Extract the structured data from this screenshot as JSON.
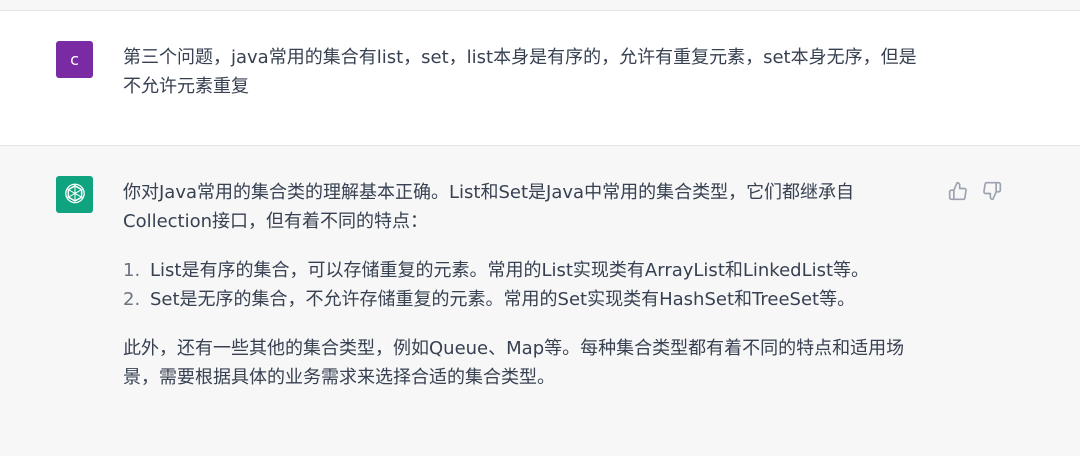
{
  "user_message": {
    "avatar_letter": "c",
    "text": "第三个问题，java常用的集合有list，set，list本身是有序的，允许有重复元素，set本身无序，但是不允许元素重复"
  },
  "assistant_message": {
    "paragraph1": "你对Java常用的集合类的理解基本正确。List和Set是Java中常用的集合类型，它们都继承自Collection接口，但有着不同的特点：",
    "list": [
      {
        "num": "1.",
        "text": "List是有序的集合，可以存储重复的元素。常用的List实现类有ArrayList和LinkedList等。"
      },
      {
        "num": "2.",
        "text": "Set是无序的集合，不允许存储重复的元素。常用的Set实现类有HashSet和TreeSet等。"
      }
    ],
    "paragraph2": "此外，还有一些其他的集合类型，例如Queue、Map等。每种集合类型都有着不同的特点和适用场景，需要根据具体的业务需求来选择合适的集合类型。"
  },
  "icons": {
    "thumbs_up": "thumbs-up-icon",
    "thumbs_down": "thumbs-down-icon",
    "bot_logo": "openai-logo-icon"
  },
  "colors": {
    "user_avatar": "#7a2ba3",
    "bot_avatar": "#10a37f",
    "assistant_bg": "#f7f7f8"
  }
}
